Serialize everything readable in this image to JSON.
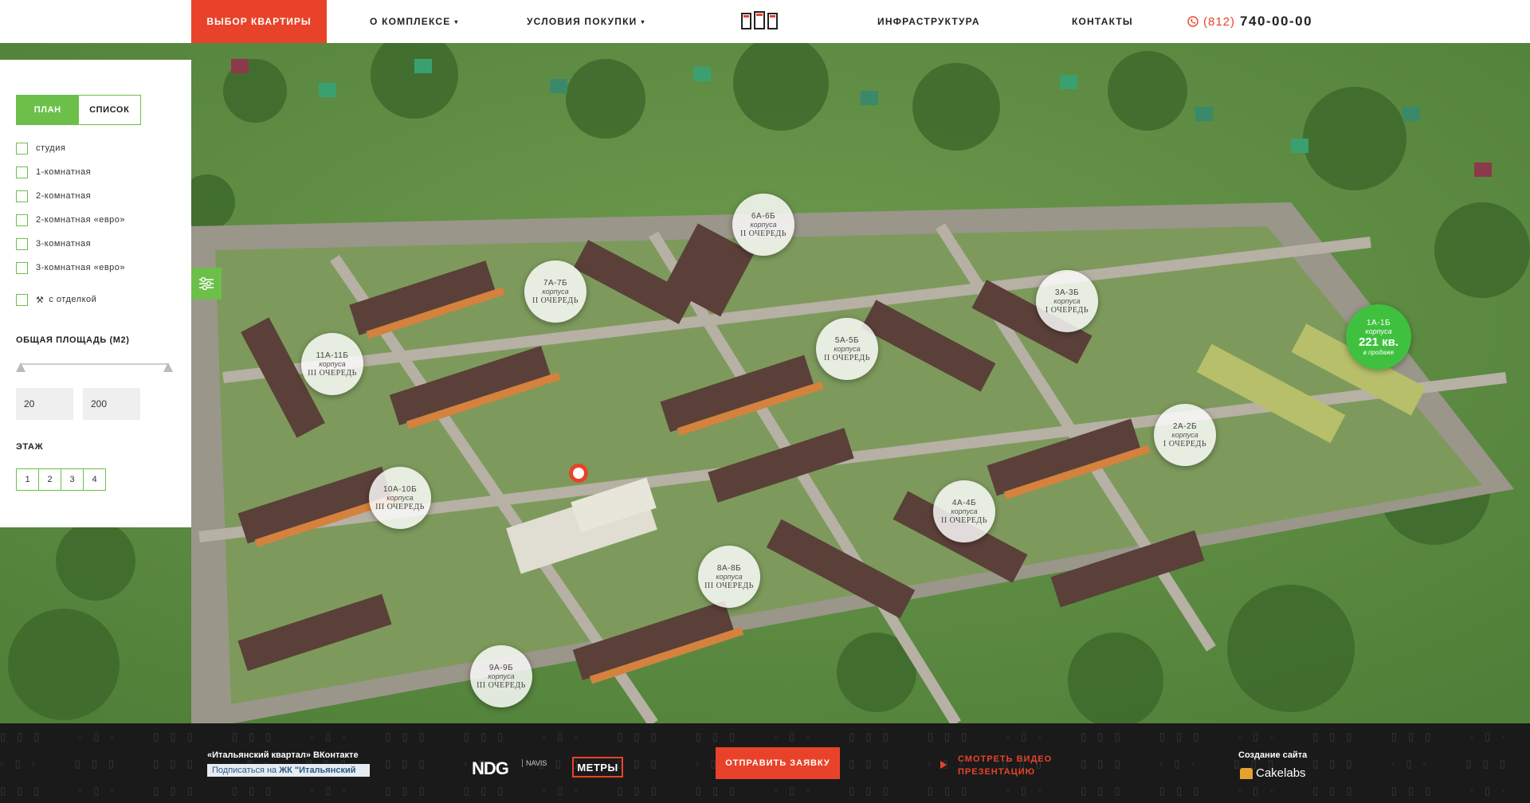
{
  "header": {
    "select_apartment": "Выбор квартиры",
    "nav": [
      {
        "label": "О комплексе",
        "caret": "▾"
      },
      {
        "label": "Условия покупки",
        "caret": "▾"
      },
      {
        "label": "Инфраструктура",
        "caret": ""
      },
      {
        "label": "Контакты",
        "caret": ""
      }
    ],
    "phone_code": "(812)",
    "phone_number": "740-00-00"
  },
  "filter": {
    "view_plan": "План",
    "view_list": "Список",
    "room_types": [
      "студия",
      "1-комнатная",
      "2-комнатная",
      "2-комнатная «евро»",
      "3-комнатная",
      "3-комнатная «евро»"
    ],
    "finish_label": "с отделкой",
    "area_title": "ОБЩАЯ ПЛОЩАДЬ (М2)",
    "area_min": "20",
    "area_max": "200",
    "floor_title": "ЭТАЖ",
    "floors": [
      "1",
      "2",
      "3",
      "4"
    ]
  },
  "markers": [
    {
      "code": "6А-6Б",
      "sub": "корпуса",
      "queue": "II ОЧЕРЕДЬ"
    },
    {
      "code": "7А-7Б",
      "sub": "корпуса",
      "queue": "II ОЧЕРЕДЬ"
    },
    {
      "code": "3А-3Б",
      "sub": "корпуса",
      "queue": "I ОЧЕРЕДЬ"
    },
    {
      "code": "11А-11Б",
      "sub": "корпуса",
      "queue": "III ОЧЕРЕДЬ"
    },
    {
      "code": "5А-5Б",
      "sub": "корпуса",
      "queue": "II ОЧЕРЕДЬ"
    },
    {
      "code": "2А-2Б",
      "sub": "корпуса",
      "queue": "I ОЧЕРЕДЬ"
    },
    {
      "code": "10А-10Б",
      "sub": "корпуса",
      "queue": "III ОЧЕРЕДЬ"
    },
    {
      "code": "4А-4Б",
      "sub": "корпуса",
      "queue": "II ОЧЕРЕДЬ"
    },
    {
      "code": "8А-8Б",
      "sub": "корпуса",
      "queue": "III ОЧЕРЕДЬ"
    },
    {
      "code": "9А-9Б",
      "sub": "корпуса",
      "queue": "III ОЧЕРЕДЬ"
    }
  ],
  "sale_marker": {
    "code": "1А-1Б",
    "sub": "корпуса",
    "count": "221 кв.",
    "tag": "в продаже"
  },
  "footer": {
    "vk_title": "«Итальянский квартал» ВКонтакте",
    "vk_subscribe": "Подписаться на",
    "vk_group": "ЖК \"Итальянский",
    "ndg": "NDG",
    "navis": "NAVIS",
    "metry": "МЕТРЫ",
    "send_request": "ОТПРАВИТЬ ЗАЯВКУ",
    "video": "СМОТРЕТЬ ВИДЕО ПРЕЗЕНТАЦИЮ",
    "created_by": "Создание сайта",
    "cakelabs": "Cakelabs"
  },
  "colors": {
    "accent_red": "#e8432a",
    "accent_green": "#6cc04a",
    "sale_green": "#3fc13f"
  }
}
